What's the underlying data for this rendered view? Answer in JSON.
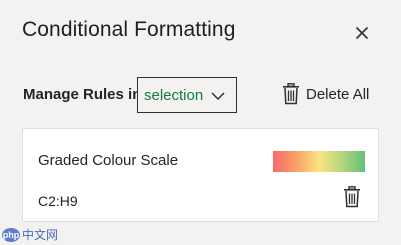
{
  "pane": {
    "title": "Conditional Formatting",
    "close_icon": "close-icon"
  },
  "manage": {
    "label": "Manage Rules in",
    "scope_value": "selection",
    "dropdown_icon": "chevron-down-icon"
  },
  "delete_all": {
    "label": "Delete All",
    "icon": "trash-icon"
  },
  "rules": [
    {
      "name": "Graded Colour Scale",
      "range": "C2:H9",
      "scale_colors": [
        "#f8696b",
        "#f9a066",
        "#fbe484",
        "#b4d67b",
        "#63be7b"
      ],
      "delete_icon": "trash-icon"
    }
  ],
  "watermark": {
    "logo": "php",
    "text": "中文网"
  },
  "colors": {
    "accent": "#107c41",
    "background": "#f3f2f1",
    "card": "#ffffff"
  }
}
